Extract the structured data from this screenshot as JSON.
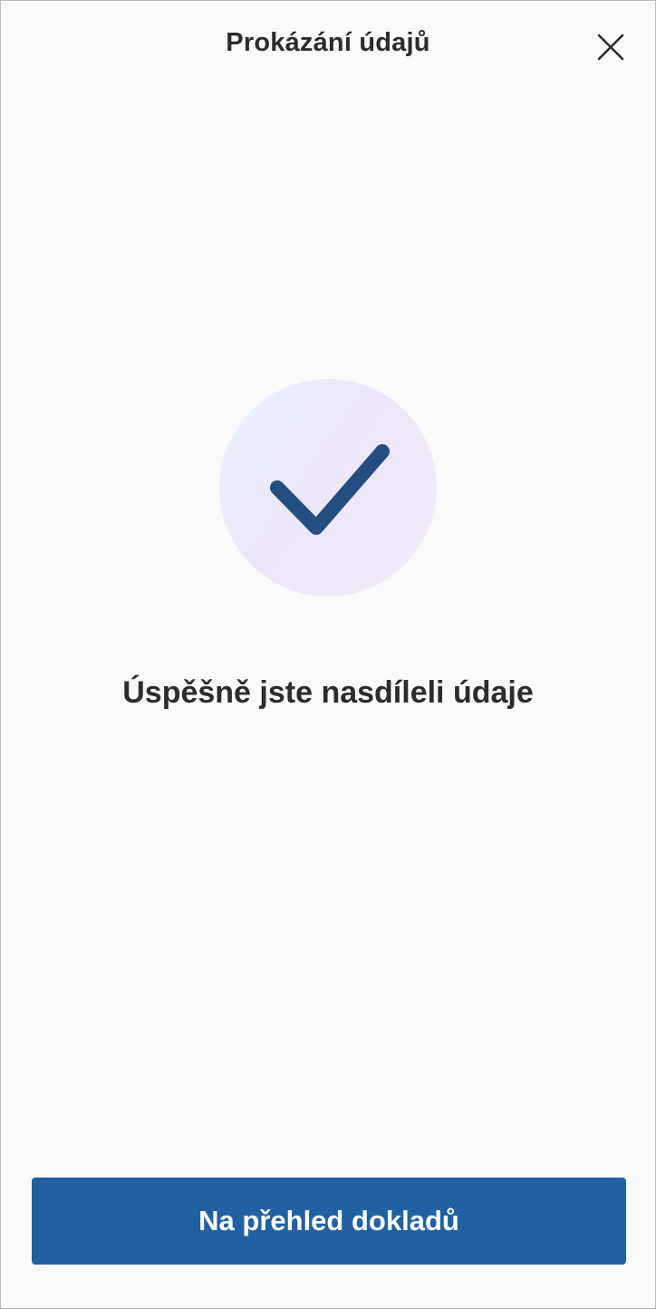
{
  "header": {
    "title": "Prokázání údajů",
    "close_icon": "close-icon"
  },
  "result": {
    "icon": "checkmark-icon",
    "message": "Úspěšně jste nasdíleli údaje"
  },
  "footer": {
    "primary_button_label": "Na přehled dokladů"
  },
  "colors": {
    "background": "#f9f9f9",
    "text": "#2c2c2c",
    "primary": "#2161a2",
    "checkmark": "#234e82"
  }
}
